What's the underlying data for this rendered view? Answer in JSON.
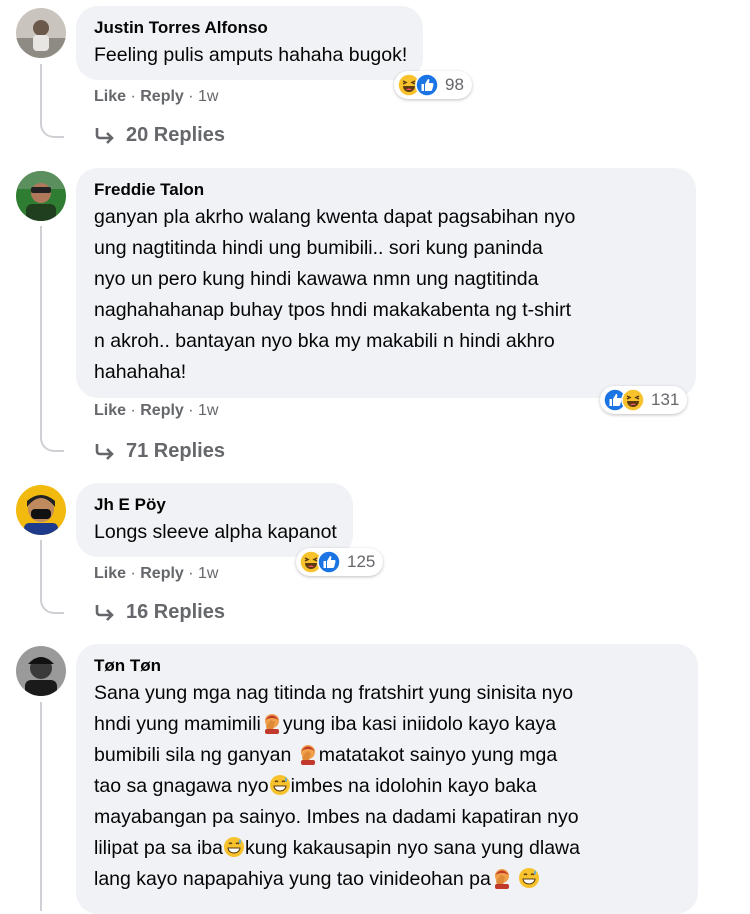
{
  "comments": [
    {
      "author": "Justin Torres Alfonso",
      "text": "Feeling pulis amputs hahaha bugok!",
      "like": "Like",
      "reply": "Reply",
      "time": "1w",
      "reaction_count": "98",
      "reactions": [
        "haha-icon",
        "like-icon"
      ],
      "replies": "20 Replies"
    },
    {
      "author": "Freddie Talon",
      "lines": [
        "ganyan pla akrho walang kwenta dapat pagsabihan nyo",
        "ung nagtitinda hindi ung bumibili.. sori kung paninda",
        "nyo un pero kung hindi kawawa nmn ung nagtitinda",
        "naghahahanap buhay tpos hndi makakabenta ng t-shirt",
        "n akroh.. bantayan nyo bka my makabili n hindi akhro",
        "hahahaha!"
      ],
      "like": "Like",
      "reply": "Reply",
      "time": "1w",
      "reaction_count": "131",
      "reactions": [
        "like-icon",
        "haha-icon"
      ],
      "replies": "71 Replies"
    },
    {
      "author": "Jh E Pöy",
      "text": "Longs sleeve alpha kapanot",
      "like": "Like",
      "reply": "Reply",
      "time": "1w",
      "reaction_count": "125",
      "reactions": [
        "haha-icon",
        "like-icon"
      ],
      "replies": "16 Replies"
    },
    {
      "author": "Tøn Tøn",
      "lines": [
        {
          "t": "Sana yung mga nag titinda ng fratshirt yung sinisita nyo",
          "e": ""
        },
        {
          "t": "hndi yung mamimili",
          "e": "facepalm-emoji",
          "t2": "yung iba kasi iniidolo kayo kaya"
        },
        {
          "t": "bumibili sila ng ganyan ",
          "e": "facepalm-emoji",
          "t2": "matatakot sainyo yung mga"
        },
        {
          "t": "tao sa gnagawa nyo",
          "e": "grin-sweat-emoji",
          "t2": "imbes na idolohin kayo baka"
        },
        {
          "t": "mayabangan pa sainyo. Imbes na dadami kapatiran nyo",
          "e": ""
        },
        {
          "t": "lilipat pa sa iba",
          "e": "grin-sweat-emoji",
          "t2": "kung kakausapin nyo sana yung dlawa"
        },
        {
          "t": "lang kayo napapahiya yung tao vinideohan pa",
          "e": "facepalm-emoji",
          "t2": " ",
          "e2": "grin-sweat-emoji"
        }
      ]
    }
  ]
}
